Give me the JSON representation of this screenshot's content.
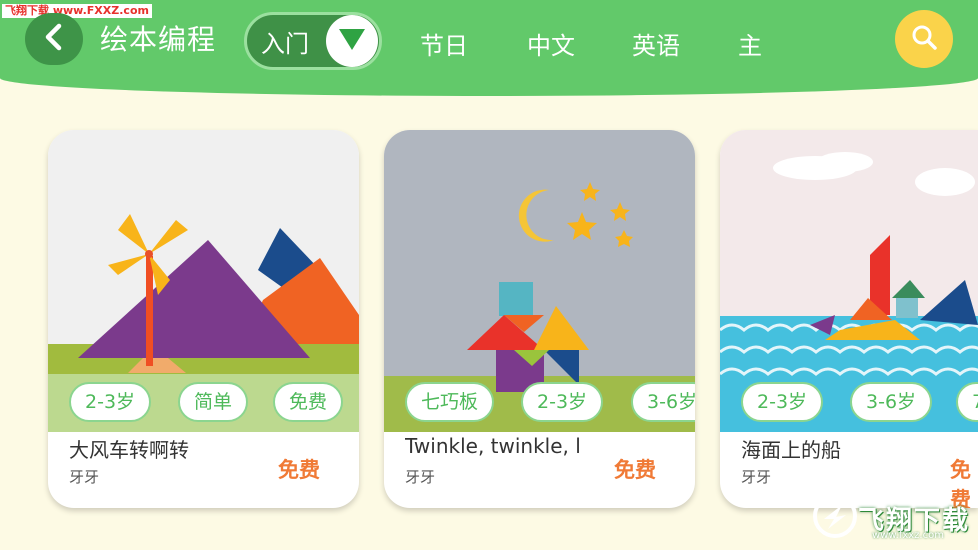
{
  "watermark": {
    "text": "飞翔下载 www.FXXZ.com"
  },
  "header": {
    "back_icon": "chevron-left-icon",
    "title": "绘本编程",
    "category": {
      "label": "入门",
      "toggle_icon": "triangle-down-icon"
    },
    "tabs": [
      "节日",
      "中文",
      "英语",
      "主"
    ],
    "search_icon": "search-icon"
  },
  "cards": [
    {
      "title": "大风车转啊转",
      "author": "牙牙",
      "price": "免费",
      "tags": [
        "2-3岁",
        "简单",
        "免费"
      ]
    },
    {
      "title": "Twinkle, twinkle, l",
      "author": "牙牙",
      "price": "免费",
      "tags": [
        "七巧板",
        "2-3岁",
        "3-6岁"
      ]
    },
    {
      "title": "海面上的船",
      "author": "牙牙",
      "price": "免费",
      "tags": [
        "2-3岁",
        "3-6岁",
        "7"
      ]
    }
  ],
  "logo": {
    "main": "飞翔下载",
    "sub": "www.fxxz.com"
  },
  "colors": {
    "header_green": "#62c96a",
    "pill_green": "#3f9147",
    "search_yellow": "#fad34a",
    "price_orange": "#f07a36",
    "tag_green": "#4eb95a",
    "background": "#fdfae4"
  }
}
